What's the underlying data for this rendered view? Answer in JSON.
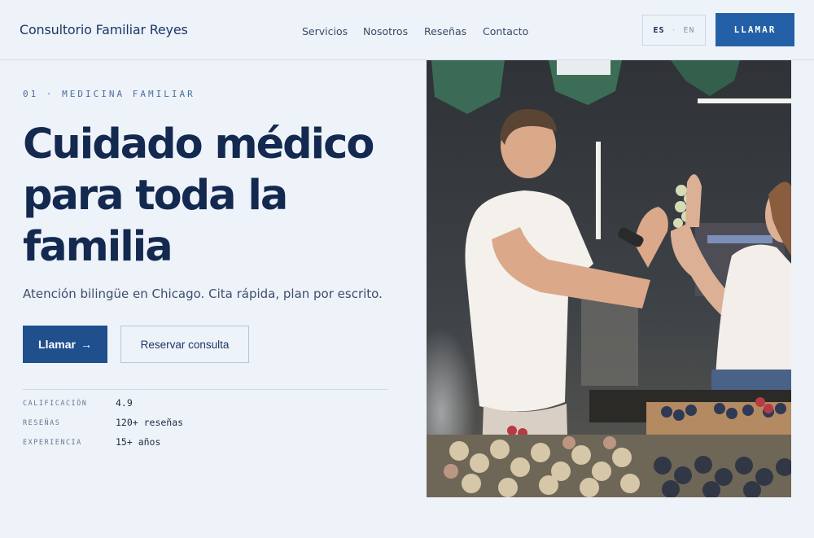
{
  "header": {
    "brand": "Consultorio Familiar Reyes",
    "nav": [
      "Servicios",
      "Nosotros",
      "Reseñas",
      "Contacto"
    ],
    "lang": {
      "active": "ES",
      "separator": "·",
      "inactive": "EN"
    },
    "call_label": "LLAMAR"
  },
  "hero": {
    "eyebrow": "01 · MEDICINA FAMILIAR",
    "title": "Cuidado médico para toda la familia",
    "subtitle": "Atención bilingüe en Chicago. Cita rápida, plan por escrito.",
    "primary_cta": "Llamar",
    "primary_cta_arrow": "→",
    "secondary_cta": "Reservar consulta",
    "stats": [
      {
        "label": "CALIFICACIÓN",
        "value": "4.9"
      },
      {
        "label": "RESEÑAS",
        "value": "120+ reseñas"
      },
      {
        "label": "EXPERIENCIA",
        "value": "15+ años"
      }
    ]
  },
  "colors": {
    "background": "#eef3fa",
    "primary": "#2460a7",
    "text_dark": "#13294f"
  },
  "icons": {
    "arrow": "arrow-right-icon"
  }
}
